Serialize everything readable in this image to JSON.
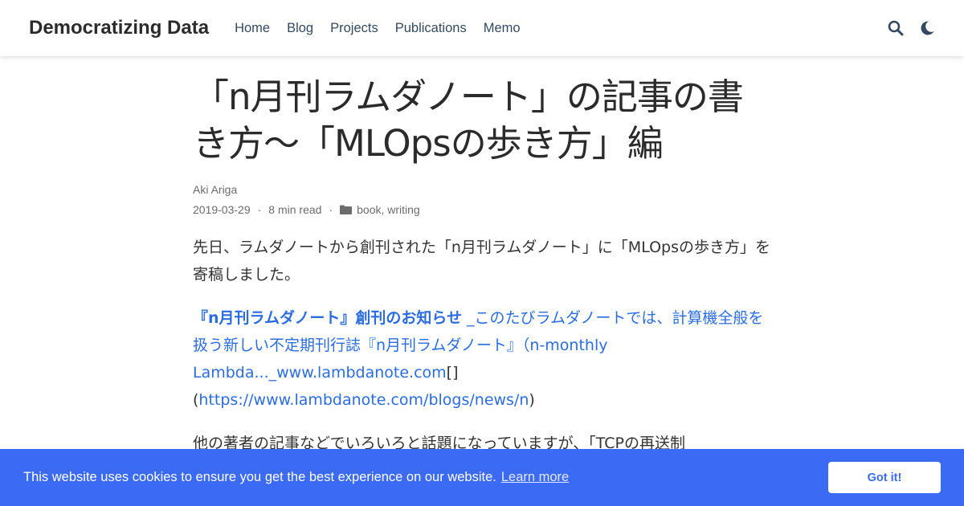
{
  "nav": {
    "brand": "Democratizing Data",
    "links": [
      "Home",
      "Blog",
      "Projects",
      "Publications",
      "Memo"
    ],
    "icons": [
      "search-icon",
      "moon-icon"
    ]
  },
  "article": {
    "title": "「n月刊ラムダノート」の記事の書き方～「MLOpsの歩き方」編",
    "author": "Aki Ariga",
    "date": "2019-03-29",
    "read_time": "8 min read",
    "categories": [
      "book",
      "writing"
    ],
    "p1": "先日、ラムダノートから創刊された「n月刊ラムダノート」に「MLOpsの歩き方」を寄稿しました。",
    "embed": {
      "bold_title": "『n月刊ラムダノート』創刊のお知らせ",
      "description": " _このたびラムダノートでは、計算機全般を扱う新しい不定期刊行誌『n月刊ラムダノート』（n-monthly Lambda..._www.lambdanote.com",
      "brackets": "[]",
      "open_paren": "(",
      "url": "https://www.lambdanote.com/blogs/news/n",
      "close_paren": ")"
    },
    "p3": "他の著者の記事などでいろいろと話題になっていますが、「TCPの再送制"
  },
  "cookie": {
    "message": "This website uses cookies to ensure you get the best experience on our website.",
    "learn_more": "Learn more",
    "button": "Got it!"
  },
  "colors": {
    "link": "#2c6ce0",
    "cookie_bg": "#3b6af5",
    "nav_text": "#34495e"
  }
}
